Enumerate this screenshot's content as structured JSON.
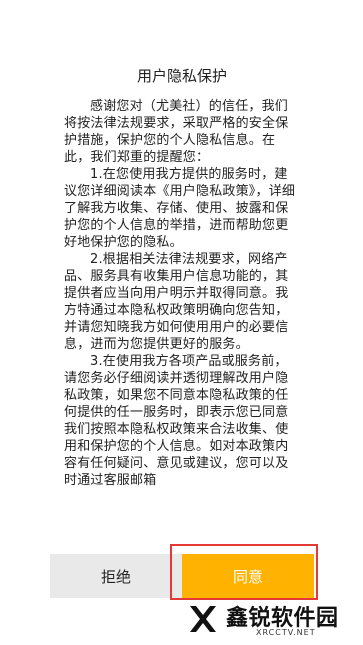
{
  "dialog": {
    "title": "用户隐私保护",
    "paragraphs": [
      "感谢您对（尤美社）的信任，我们将按法律法规要求，采取严格的安全保护措施，保护您的个人隐私信息。在此，我们郑重的提醒您：",
      "1.在您使用我方提供的服务时，建议您详细阅读本《用户隐私政策》，详细了解我方收集、存储、使用、披露和保护您的个人信息的举措，进而帮助您更好地保护您的隐私。",
      "2.根据相关法律法规要求，网络产品、服务具有收集用户信息功能的，其提供者应当向用户明示并取得同意。我方特通过本隐私权政策明确向您告知，并请您知晓我方如何使用用户的必要信息，进而为您提供更好的服务。",
      "3.在使用我方各项产品或服务前，请您务必仔细阅读并透彻理解改用户隐私政策，如果您不同意本隐私政策的任何提供的任一服务时，即表示您已同意我们按照本隐私权政策来合法收集、使用和保护您的个人信息。如对本政策内容有任何疑问、意见或建议，您可以及时通过客服邮箱"
    ],
    "reject_label": "拒绝",
    "agree_label": "同意"
  },
  "watermark": {
    "title": "鑫锐软件园",
    "subtitle": "XRCCTV.NET"
  },
  "colors": {
    "agree_button": "#ffb200",
    "reject_button": "#e9e9e9",
    "highlight_border": "#e53935"
  }
}
